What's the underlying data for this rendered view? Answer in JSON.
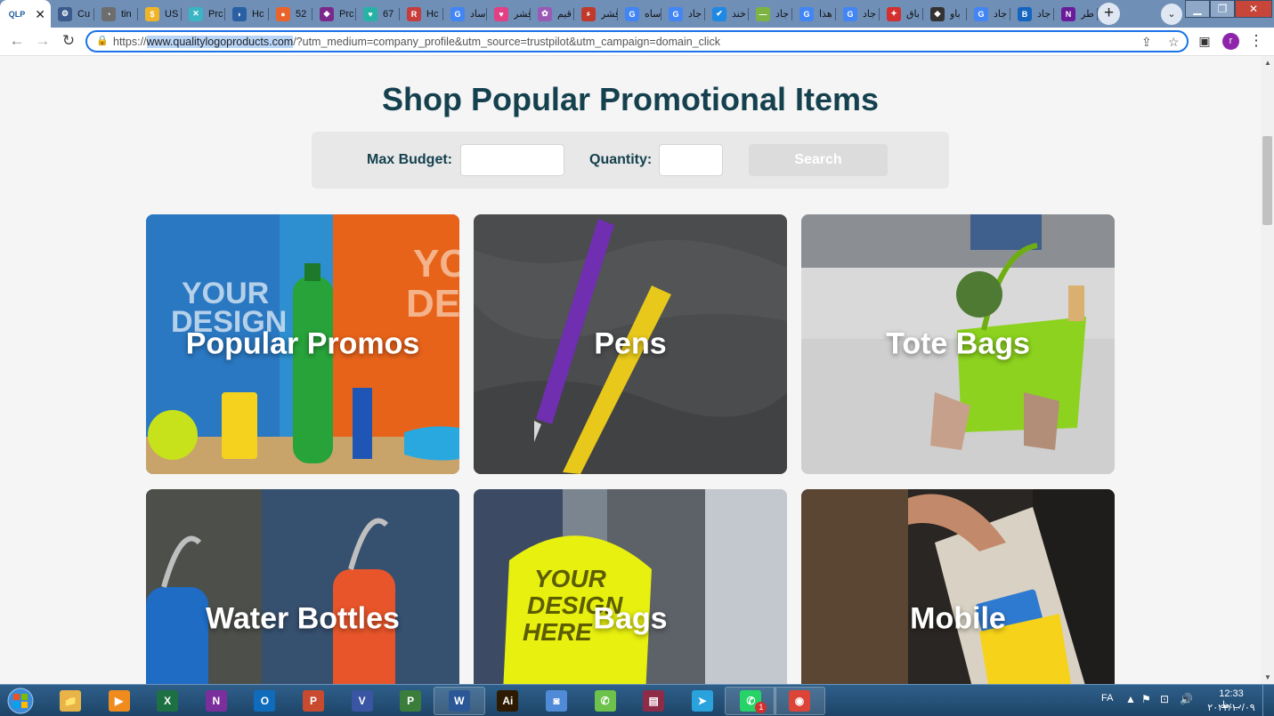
{
  "browser": {
    "tabs": [
      {
        "title": "QLP",
        "fav_color": "#1a5aa0",
        "fav_text": "QLP",
        "active": true
      },
      {
        "title": "Cu",
        "fav_color": "#3b5b8c",
        "fav_text": "⚙"
      },
      {
        "title": "tin",
        "fav_color": "#6d6d6d",
        "fav_text": "◔"
      },
      {
        "title": "US",
        "fav_color": "#f0b429",
        "fav_text": "$"
      },
      {
        "title": "Prc",
        "fav_color": "#39b5c4",
        "fav_text": "✕"
      },
      {
        "title": "Hc",
        "fav_color": "#2a5fa3",
        "fav_text": "◗"
      },
      {
        "title": "52",
        "fav_color": "#e9632b",
        "fav_text": "●"
      },
      {
        "title": "Prc",
        "fav_color": "#7b2a8c",
        "fav_text": "◆"
      },
      {
        "title": "67",
        "fav_color": "#26b3a5",
        "fav_text": "♥"
      },
      {
        "title": "Hc",
        "fav_color": "#c83c3c",
        "fav_text": "R"
      },
      {
        "title": "ساد",
        "fav_color": "#4285f4",
        "fav_text": "G"
      },
      {
        "title": "قشر",
        "fav_color": "#e23f84",
        "fav_text": "♥"
      },
      {
        "title": "قیم",
        "fav_color": "#9b59b6",
        "fav_text": "✿"
      },
      {
        "title": "قشر",
        "fav_color": "#c0392b",
        "fav_text": "ء"
      },
      {
        "title": "ساه",
        "fav_color": "#4285f4",
        "fav_text": "G"
      },
      {
        "title": "جاد",
        "fav_color": "#4285f4",
        "fav_text": "G"
      },
      {
        "title": "خند",
        "fav_color": "#1e88e5",
        "fav_text": "✔"
      },
      {
        "title": "جاد",
        "fav_color": "#7cb342",
        "fav_text": "—"
      },
      {
        "title": "هذا",
        "fav_color": "#4285f4",
        "fav_text": "G"
      },
      {
        "title": "جاد",
        "fav_color": "#4285f4",
        "fav_text": "G"
      },
      {
        "title": "باق",
        "fav_color": "#d32f2f",
        "fav_text": "✦"
      },
      {
        "title": "باو",
        "fav_color": "#333333",
        "fav_text": "◆"
      },
      {
        "title": "جاد",
        "fav_color": "#4285f4",
        "fav_text": "G"
      },
      {
        "title": "جاد",
        "fav_color": "#1565c0",
        "fav_text": "B"
      },
      {
        "title": "طر",
        "fav_color": "#6a1b9a",
        "fav_text": "N"
      }
    ],
    "url_scheme": "https://",
    "url_domain": "www.qualitylogoproducts.com",
    "url_path": "/?utm_medium=company_profile&utm_source=trustpilot&utm_campaign=domain_click",
    "profile_initial": "r"
  },
  "page": {
    "heading": "Shop Popular Promotional Items",
    "search": {
      "budget_label": "Max Budget:",
      "budget_value": "",
      "quantity_label": "Quantity:",
      "quantity_value": "",
      "button_label": "Search"
    },
    "categories": [
      {
        "label": "Popular Promos"
      },
      {
        "label": "Pens"
      },
      {
        "label": "Tote Bags"
      },
      {
        "label": "Water Bottles"
      },
      {
        "label": "Bags"
      },
      {
        "label": "Mobile"
      }
    ]
  },
  "taskbar": {
    "apps": [
      {
        "name": "file-explorer",
        "color": "#e8b447",
        "glyph": "📁"
      },
      {
        "name": "media-player",
        "color": "#f08c1e",
        "glyph": "▶"
      },
      {
        "name": "excel",
        "color": "#1d7044",
        "glyph": "X"
      },
      {
        "name": "onenote",
        "color": "#7b2f9c",
        "glyph": "N"
      },
      {
        "name": "outlook",
        "color": "#0f6cbd",
        "glyph": "O"
      },
      {
        "name": "powerpoint",
        "color": "#c84b30",
        "glyph": "P"
      },
      {
        "name": "visio",
        "color": "#3955a3",
        "glyph": "V"
      },
      {
        "name": "project",
        "color": "#3b7d3a",
        "glyph": "P"
      },
      {
        "name": "word",
        "color": "#2b5797",
        "glyph": "W"
      },
      {
        "name": "illustrator",
        "color": "#2d1a00",
        "glyph": "Ai"
      },
      {
        "name": "control-panel",
        "color": "#4f8bd6",
        "glyph": "◙"
      },
      {
        "name": "phone",
        "color": "#6dc24b",
        "glyph": "✆"
      },
      {
        "name": "winrar",
        "color": "#8e2c48",
        "glyph": "▤"
      },
      {
        "name": "telegram",
        "color": "#2aa3dd",
        "glyph": "➤"
      },
      {
        "name": "whatsapp",
        "color": "#25d366",
        "glyph": "✆"
      },
      {
        "name": "chrome",
        "color": "#db4437",
        "glyph": "◉"
      }
    ],
    "lang": "FA",
    "time": "12:33 ب.ظ",
    "date": "۲۰۲۲/۱۰/۰۹",
    "whatsapp_badge": "1"
  }
}
